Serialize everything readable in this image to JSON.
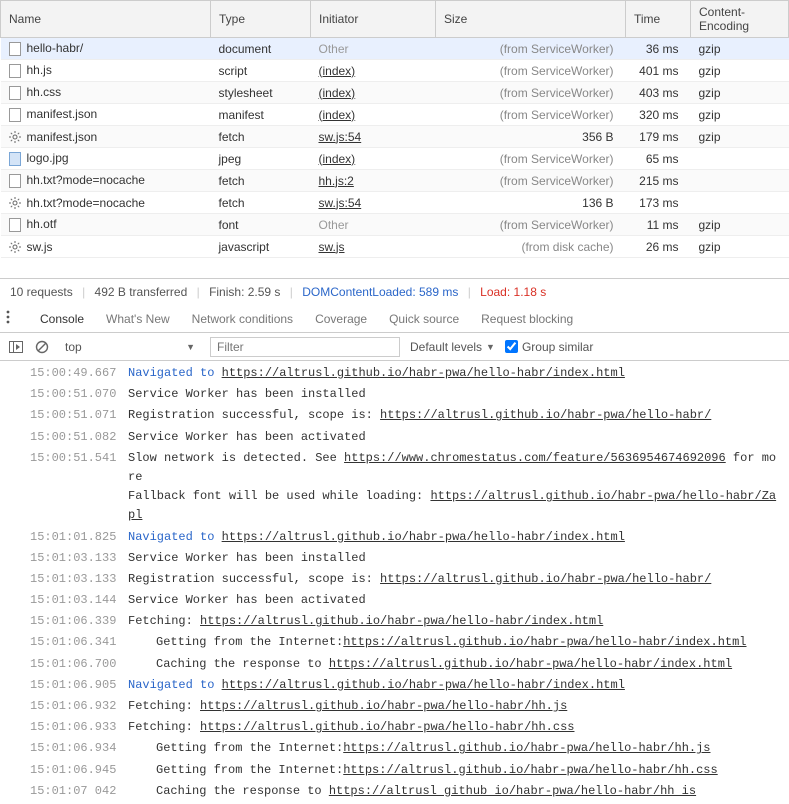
{
  "network": {
    "columns": [
      "Name",
      "Type",
      "Initiator",
      "Size",
      "Time",
      "Content-Encoding"
    ],
    "rows": [
      {
        "name": "hello-habr/",
        "icon": "file",
        "type": "document",
        "initiator": "Other",
        "initiatorLink": false,
        "size": "(from ServiceWorker)",
        "sizeLight": true,
        "time": "36 ms",
        "enc": "gzip",
        "selected": true
      },
      {
        "name": "hh.js",
        "icon": "file",
        "type": "script",
        "initiator": "(index)",
        "initiatorLink": true,
        "size": "(from ServiceWorker)",
        "sizeLight": true,
        "time": "401 ms",
        "enc": "gzip"
      },
      {
        "name": "hh.css",
        "icon": "file",
        "type": "stylesheet",
        "initiator": "(index)",
        "initiatorLink": true,
        "size": "(from ServiceWorker)",
        "sizeLight": true,
        "time": "403 ms",
        "enc": "gzip"
      },
      {
        "name": "manifest.json",
        "icon": "file",
        "type": "manifest",
        "initiator": "(index)",
        "initiatorLink": true,
        "size": "(from ServiceWorker)",
        "sizeLight": true,
        "time": "320 ms",
        "enc": "gzip"
      },
      {
        "name": "manifest.json",
        "icon": "gear",
        "type": "fetch",
        "initiator": "sw.js:54",
        "initiatorLink": true,
        "size": "356 B",
        "sizeLight": false,
        "time": "179 ms",
        "enc": "gzip"
      },
      {
        "name": "logo.jpg",
        "icon": "jpeg",
        "type": "jpeg",
        "initiator": "(index)",
        "initiatorLink": true,
        "size": "(from ServiceWorker)",
        "sizeLight": true,
        "time": "65 ms",
        "enc": ""
      },
      {
        "name": "hh.txt?mode=nocache",
        "icon": "file",
        "type": "fetch",
        "initiator": "hh.js:2",
        "initiatorLink": true,
        "size": "(from ServiceWorker)",
        "sizeLight": true,
        "time": "215 ms",
        "enc": ""
      },
      {
        "name": "hh.txt?mode=nocache",
        "icon": "gear",
        "type": "fetch",
        "initiator": "sw.js:54",
        "initiatorLink": true,
        "size": "136 B",
        "sizeLight": false,
        "time": "173 ms",
        "enc": ""
      },
      {
        "name": "hh.otf",
        "icon": "file",
        "type": "font",
        "initiator": "Other",
        "initiatorLink": false,
        "size": "(from ServiceWorker)",
        "sizeLight": true,
        "time": "11 ms",
        "enc": "gzip"
      },
      {
        "name": "sw.js",
        "icon": "gear",
        "type": "javascript",
        "initiator": "sw.js",
        "initiatorLink": true,
        "size": "(from disk cache)",
        "sizeLight": true,
        "time": "26 ms",
        "enc": "gzip"
      }
    ]
  },
  "statusBar": {
    "requests": "10 requests",
    "transferred": "492 B transferred",
    "finish": "Finish: 2.59 s",
    "domLoaded": "DOMContentLoaded: 589 ms",
    "load": "Load: 1.18 s"
  },
  "drawerTabs": [
    "Console",
    "What's New",
    "Network conditions",
    "Coverage",
    "Quick source",
    "Request blocking"
  ],
  "consoleToolbar": {
    "context": "top",
    "filterPlaceholder": "Filter",
    "levels": "Default levels",
    "groupLabel": "Group similar"
  },
  "consoleLog": [
    {
      "ts": "15:00:49.667",
      "parts": [
        {
          "t": "Navigated to ",
          "cls": "nav"
        },
        {
          "t": "https://altrusl.github.io/habr-pwa/hello-habr/index.html",
          "link": true
        }
      ]
    },
    {
      "ts": "15:00:51.070",
      "parts": [
        {
          "t": "Service Worker has been installed"
        }
      ]
    },
    {
      "ts": "15:00:51.071",
      "parts": [
        {
          "t": "Registration successful, scope is: "
        },
        {
          "t": "https://altrusl.github.io/habr-pwa/hello-habr/",
          "link": true
        }
      ]
    },
    {
      "ts": "15:00:51.082",
      "parts": [
        {
          "t": "Service Worker has been activated"
        }
      ]
    },
    {
      "ts": "15:00:51.541",
      "parts": [
        {
          "t": "Slow network is detected. See "
        },
        {
          "t": "https://www.chromestatus.com/feature/5636954674692096",
          "link": true
        },
        {
          "t": " for more"
        }
      ],
      "extra": [
        {
          "t": "Fallback font will be used while loading: "
        },
        {
          "t": "https://altrusl.github.io/habr-pwa/hello-habr/Zapl",
          "link": true
        }
      ]
    },
    {
      "ts": "15:01:01.825",
      "parts": [
        {
          "t": "Navigated to ",
          "cls": "nav"
        },
        {
          "t": "https://altrusl.github.io/habr-pwa/hello-habr/index.html",
          "link": true
        }
      ]
    },
    {
      "ts": "15:01:03.133",
      "parts": [
        {
          "t": "Service Worker has been installed"
        }
      ]
    },
    {
      "ts": "15:01:03.133",
      "parts": [
        {
          "t": "Registration successful, scope is: "
        },
        {
          "t": "https://altrusl.github.io/habr-pwa/hello-habr/",
          "link": true
        }
      ]
    },
    {
      "ts": "15:01:03.144",
      "parts": [
        {
          "t": "Service Worker has been activated"
        }
      ]
    },
    {
      "ts": "15:01:06.339",
      "parts": [
        {
          "t": "Fetching: "
        },
        {
          "t": "https://altrusl.github.io/habr-pwa/hello-habr/index.html",
          "link": true
        }
      ]
    },
    {
      "ts": "15:01:06.341",
      "parts": [
        {
          "t": "Getting from the Internet:",
          "indent": true
        },
        {
          "t": "https://altrusl.github.io/habr-pwa/hello-habr/index.html",
          "link": true
        }
      ]
    },
    {
      "ts": "15:01:06.700",
      "parts": [
        {
          "t": "Caching the response to ",
          "indent": true
        },
        {
          "t": "https://altrusl.github.io/habr-pwa/hello-habr/index.html",
          "link": true
        }
      ]
    },
    {
      "ts": "15:01:06.905",
      "parts": [
        {
          "t": "Navigated to ",
          "cls": "nav"
        },
        {
          "t": "https://altrusl.github.io/habr-pwa/hello-habr/index.html",
          "link": true
        }
      ]
    },
    {
      "ts": "15:01:06.932",
      "parts": [
        {
          "t": "Fetching: "
        },
        {
          "t": "https://altrusl.github.io/habr-pwa/hello-habr/hh.js",
          "link": true
        }
      ]
    },
    {
      "ts": "15:01:06.933",
      "parts": [
        {
          "t": "Fetching: "
        },
        {
          "t": "https://altrusl.github.io/habr-pwa/hello-habr/hh.css",
          "link": true
        }
      ]
    },
    {
      "ts": "15:01:06.934",
      "parts": [
        {
          "t": "Getting from the Internet:",
          "indent": true
        },
        {
          "t": "https://altrusl.github.io/habr-pwa/hello-habr/hh.js",
          "link": true
        }
      ]
    },
    {
      "ts": "15:01:06.945",
      "parts": [
        {
          "t": "Getting from the Internet:",
          "indent": true
        },
        {
          "t": "https://altrusl.github.io/habr-pwa/hello-habr/hh.css",
          "link": true
        }
      ]
    },
    {
      "ts": "15:01:07 042",
      "parts": [
        {
          "t": "Caching the response to ",
          "indent": true
        },
        {
          "t": "https://altrusl github io/habr-pwa/hello-habr/hh is",
          "link": true
        }
      ]
    }
  ]
}
